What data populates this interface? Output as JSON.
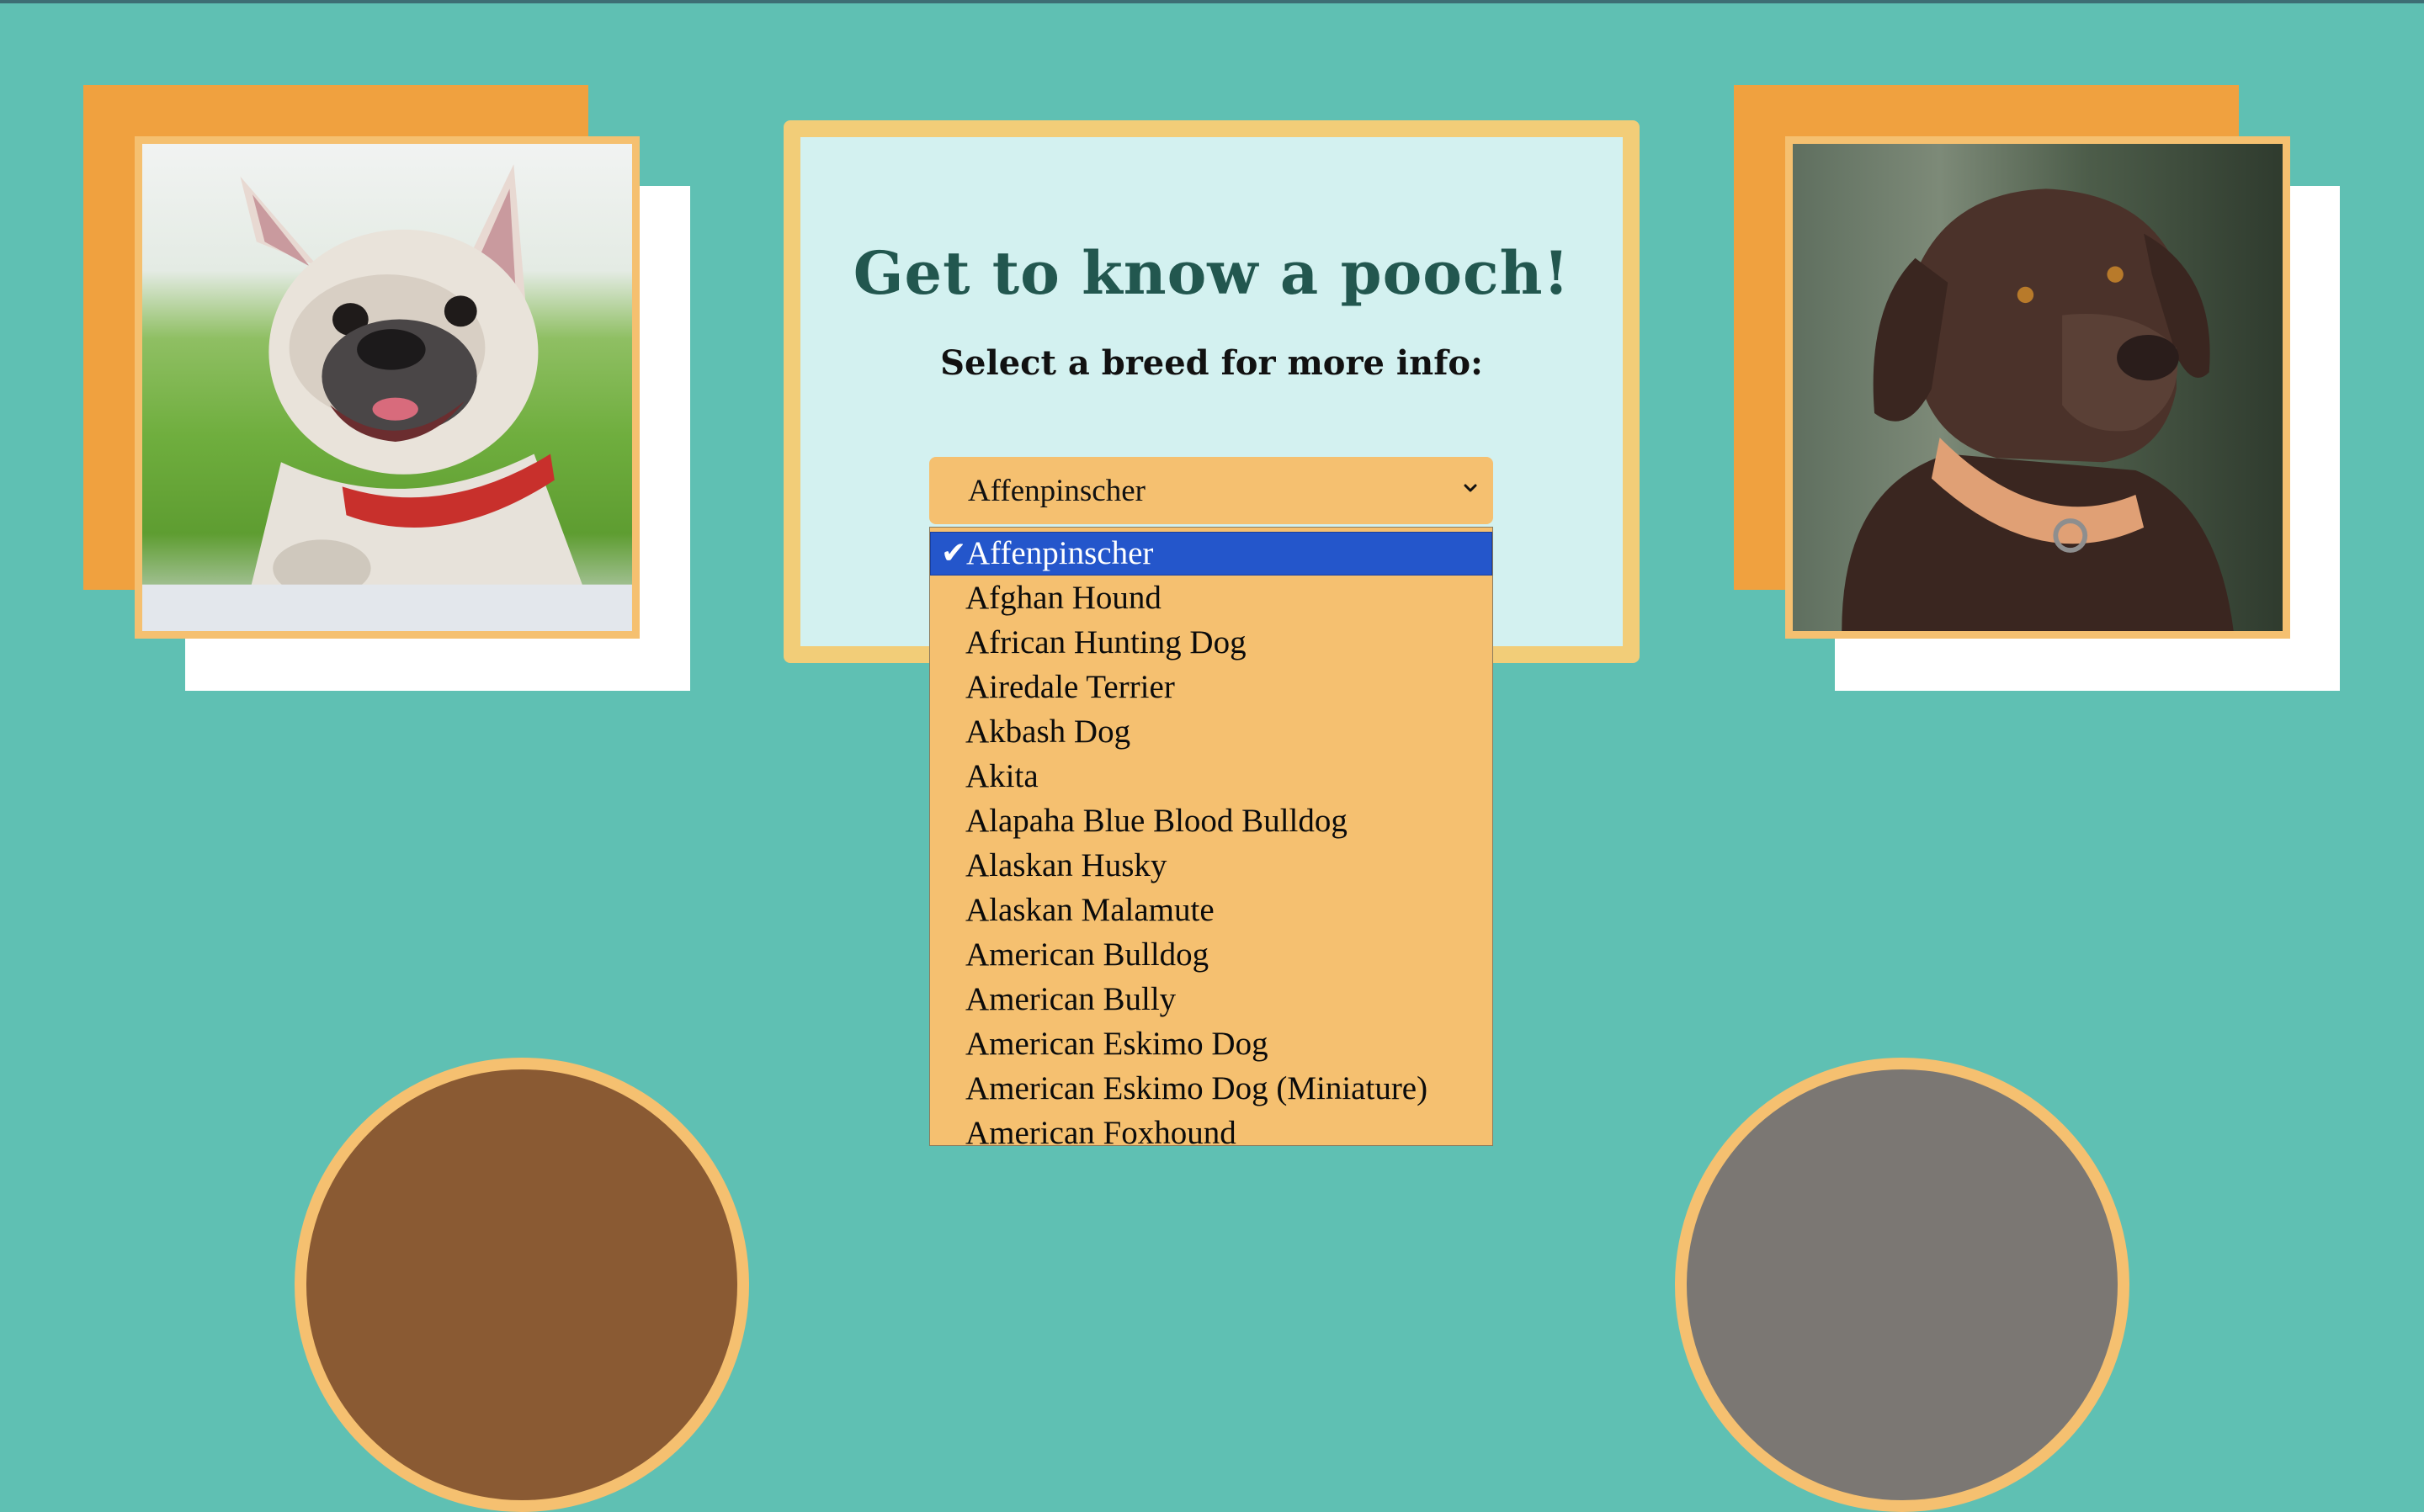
{
  "page": {
    "heading": "Get to know a pooch!",
    "subheading": "Select a breed for more info:"
  },
  "breed_select": {
    "selected_value": "Affenpinscher",
    "options": [
      "Affenpinscher",
      "Afghan Hound",
      "African Hunting Dog",
      "Airedale Terrier",
      "Akbash Dog",
      "Akita",
      "Alapaha Blue Blood Bulldog",
      "Alaskan Husky",
      "Alaskan Malamute",
      "American Bulldog",
      "American Bully",
      "American Eskimo Dog",
      "American Eskimo Dog (Miniature)",
      "American Foxhound"
    ],
    "check_icon": "checkmark-icon",
    "chevron_icon": "chevron-down-icon"
  },
  "images": {
    "left": "french-bulldog-photo",
    "right": "chocolate-labrador-photo"
  },
  "colors": {
    "background": "#5fc0b3",
    "accent_orange": "#f0a13f",
    "frame_gold": "#f5c070",
    "card_bg": "#d3f1f0",
    "heading": "#22574f",
    "selected_option": "#2456cb"
  }
}
